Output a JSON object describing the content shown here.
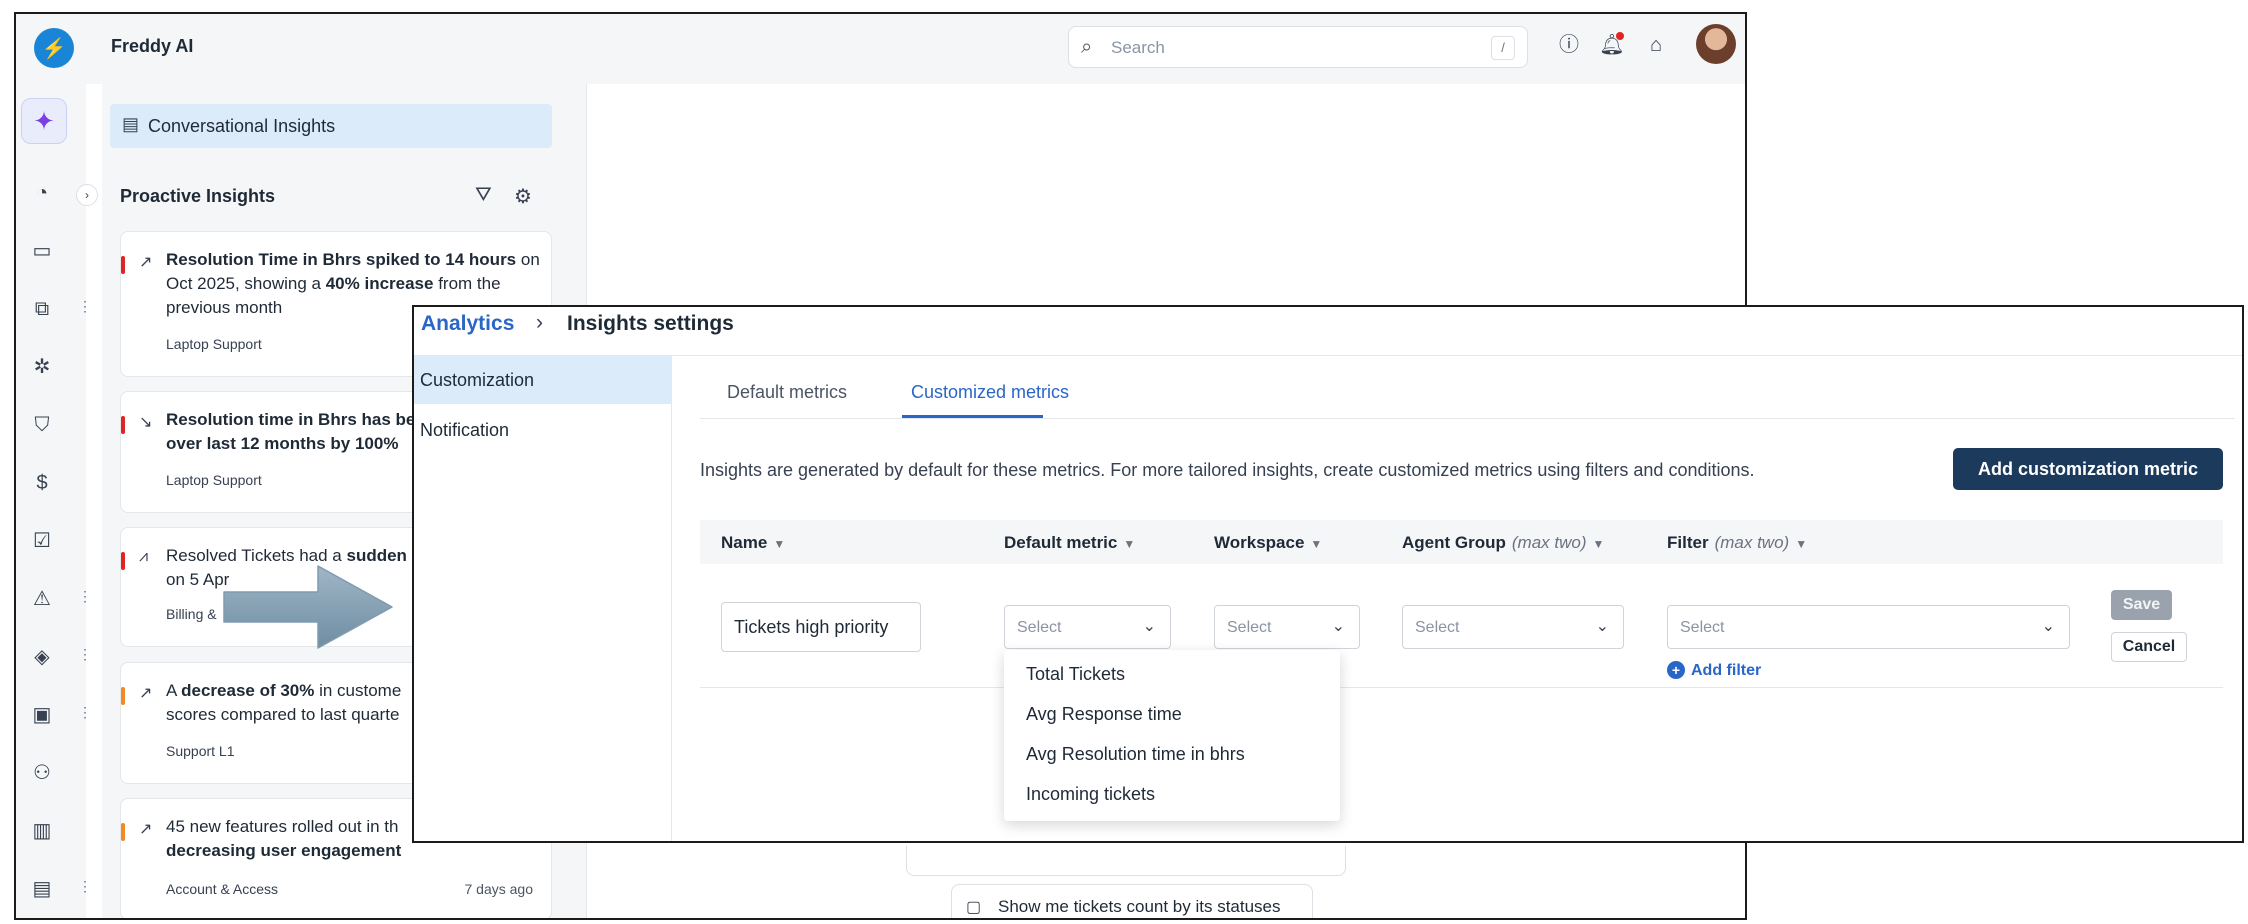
{
  "app": {
    "title": "Freddy AI",
    "logo_icon": "lightning-bolt",
    "search": {
      "placeholder": "Search",
      "shortcut": "/"
    },
    "topbar_icons": [
      "help-icon",
      "notification-bell-icon",
      "marketplace-icon",
      "user-avatar"
    ]
  },
  "rail": {
    "icons": [
      "sparkle-icon",
      "dashboard-icon",
      "ticket-icon",
      "workflow-icon",
      "bug-icon",
      "shield-icon",
      "currency-icon",
      "checklist-icon",
      "alert-icon",
      "layers-icon",
      "contacts-icon",
      "user-settings-icon",
      "book-icon",
      "analytics-icon"
    ]
  },
  "panel": {
    "conversational_label": "Conversational Insights",
    "proactive_title": "Proactive Insights",
    "cards": [
      {
        "bar_color": "#e02424",
        "p1": "Resolution Time in Bhrs spiked to 14 hours",
        "p2": " on Oct 2025, showing a ",
        "p3": "40% increase",
        "p4": " from the previous month",
        "tag": "Laptop Support",
        "age": ""
      },
      {
        "bar_color": "#e02424",
        "p1": "Resolution time in Bhrs has be",
        "p2": "",
        "p3": "over last 12 months by 100%",
        "p4": "",
        "tag": "Laptop Support",
        "age": ""
      },
      {
        "bar_color": "#e02424",
        "p1": "Resolved Tickets had a ",
        "p2": "sudden",
        "p3": "",
        "p4": "on 5 Apr",
        "tag": "Billing &",
        "age": ""
      },
      {
        "bar_color": "#f08a24",
        "p1": "A ",
        "p2": "decrease of 30%",
        "p3": " in custome",
        "p4": "scores compared to last quarte",
        "tag": "Support L1",
        "age": ""
      },
      {
        "bar_color": "#f08a24",
        "p1": "45 new features rolled out in th",
        "p2": "decreasing user engagement",
        "p3": "",
        "p4": "",
        "tag": "Account & Access",
        "age": "7 days ago"
      }
    ],
    "chat_chip": "Show me tickets count by its statuses"
  },
  "settings": {
    "breadcrumb_link": "Analytics",
    "breadcrumb_sep": "›",
    "breadcrumb_current": "Insights settings",
    "side_items": [
      "Customization",
      "Notification"
    ],
    "tabs": [
      "Default metrics",
      "Customized metrics"
    ],
    "active_tab": "Customized metrics",
    "info_text": "Insights are generated by default for these metrics. For more tailored insights, create customized metrics using filters and conditions.",
    "add_button": "Add customization metric",
    "columns": [
      {
        "label": "Name",
        "sub": ""
      },
      {
        "label": "Default metric",
        "sub": ""
      },
      {
        "label": "Workspace",
        "sub": ""
      },
      {
        "label": "Agent Group",
        "sub": "(max two)"
      },
      {
        "label": "Filter",
        "sub": "(max two)"
      }
    ],
    "row": {
      "name_value": "Tickets high priority",
      "select_placeholder": "Select",
      "add_filter": "Add filter",
      "save": "Save",
      "cancel": "Cancel"
    },
    "dropdown_options": [
      "Total Tickets",
      "Avg Response time",
      "Avg Resolution time in bhrs",
      "Incoming tickets"
    ]
  },
  "colors": {
    "accent": "#2a66c7",
    "primary_button": "#1c3a5c",
    "alert_red": "#e02424",
    "alert_orange": "#f08a24",
    "selected_bg": "#dcebfa"
  }
}
